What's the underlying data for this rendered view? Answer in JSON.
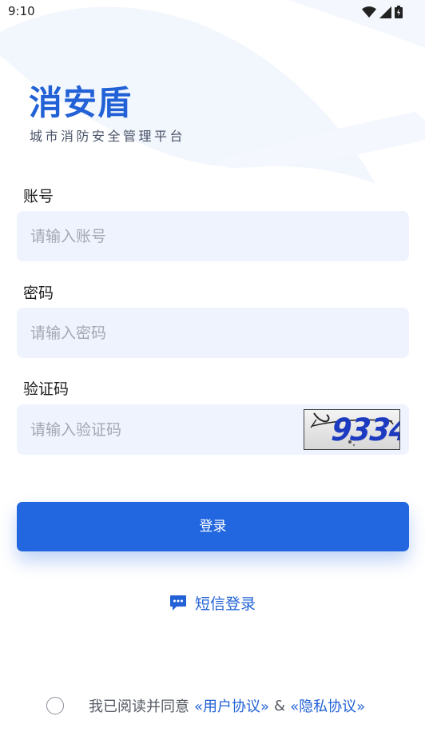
{
  "status_bar": {
    "time": "9:10",
    "icons": [
      "wifi-icon",
      "cellular-signal-icon",
      "battery-icon"
    ]
  },
  "brand": {
    "title": "消安盾",
    "subtitle": "城市消防安全管理平台"
  },
  "form": {
    "account": {
      "label": "账号",
      "placeholder": "请输入账号"
    },
    "password": {
      "label": "密码",
      "placeholder": "请输入密码"
    },
    "captcha": {
      "label": "验证码",
      "placeholder": "请输入验证码",
      "image_text": "9334"
    }
  },
  "login_button": {
    "label": "登录"
  },
  "sms_login": {
    "icon": "chat-bubble-icon",
    "label": "短信登录"
  },
  "agreement": {
    "prefix": "我已阅读并同意",
    "user_agreement": "«用户协议»",
    "separator": "&",
    "privacy_agreement": "«隐私协议»"
  },
  "colors": {
    "primary": "#2266e0",
    "brand_text": "#2262d6",
    "input_bg": "#eef3fd",
    "placeholder": "#a3a8b2"
  }
}
